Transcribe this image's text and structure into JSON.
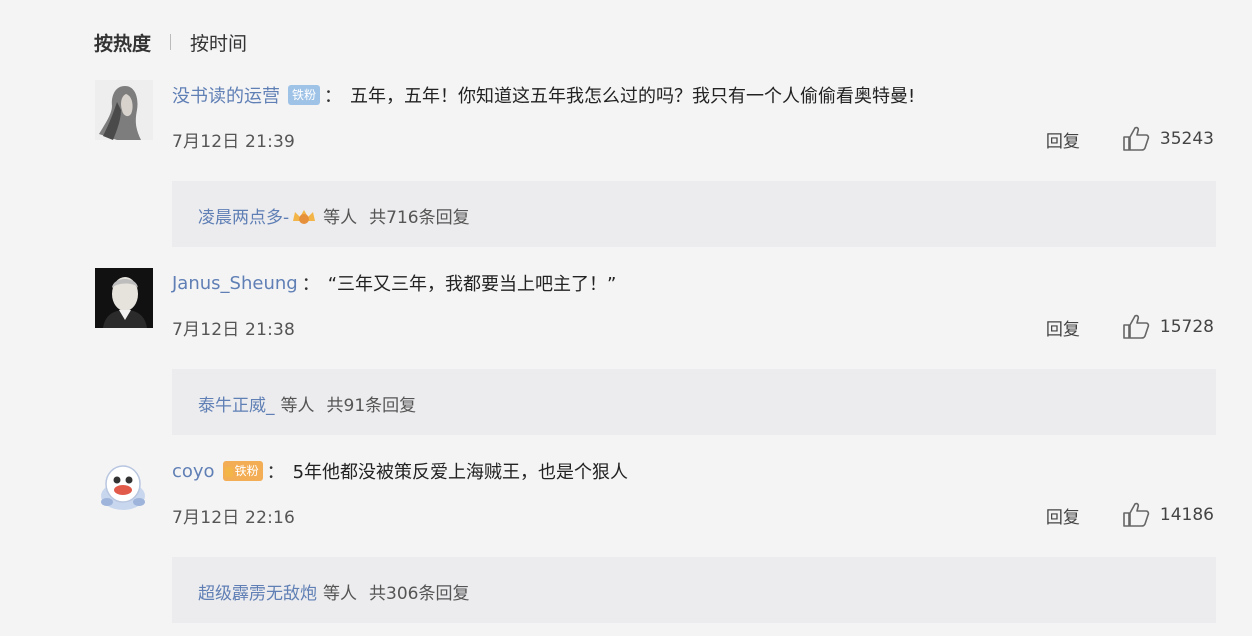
{
  "sort": {
    "hot_label": "按热度",
    "time_label": "按时间",
    "active": "hot"
  },
  "comments": [
    {
      "username": "没书读的运营",
      "badge": "铁粉",
      "colon": "：",
      "text": "五年，五年！你知道这五年我怎么过的吗？我只有一个人偷偷看奥特曼!",
      "time": "7月12日 21:39",
      "reply_label": "回复",
      "likes": "35243",
      "reply_summary": {
        "name": "凌晨两点多-",
        "tail": "等人",
        "count": "共716条回复"
      }
    },
    {
      "username": "Janus_Sheung",
      "badge": "",
      "colon": "：",
      "text": "“三年又三年，我都要当上吧主了！”",
      "time": "7月12日 21:38",
      "reply_label": "回复",
      "likes": "15728",
      "reply_summary": {
        "name": "泰牛正威_",
        "tail": "等人",
        "count": "共91条回复"
      }
    },
    {
      "username": "coyo",
      "badge": "铁粉",
      "colon": "：",
      "text": "5年他都没被策反爱上海贼王，也是个狠人",
      "time": "7月12日 22:16",
      "reply_label": "回复",
      "likes": "14186",
      "reply_summary": {
        "name": "超级霹雳无敌炮",
        "tail": "等人",
        "count": "共306条回复"
      }
    }
  ],
  "colors": {
    "username": "#5f7fb5",
    "badge_blue": "#9fc3e7",
    "badge_orange": "#f3ad55",
    "reply_bg": "#ececee"
  }
}
